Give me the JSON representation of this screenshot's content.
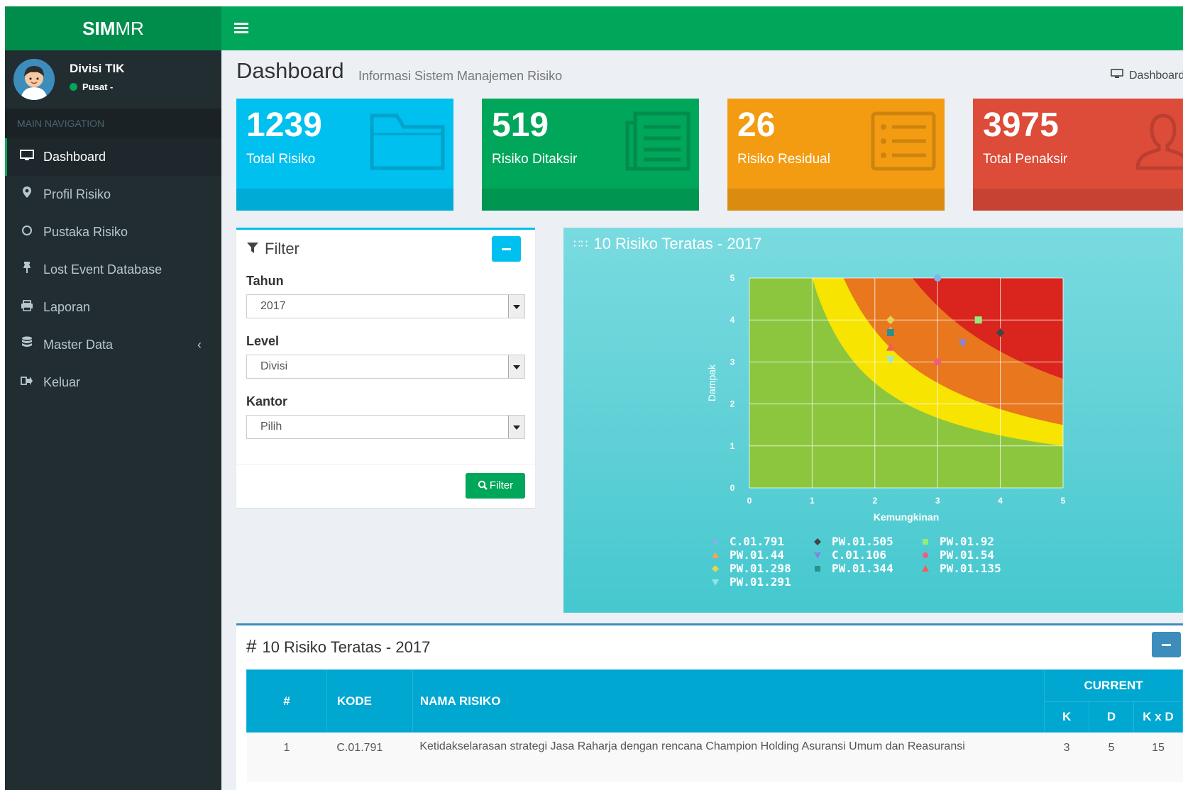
{
  "app": {
    "logo_bold": "SIM",
    "logo_rest": "MR"
  },
  "user": {
    "name": "Divisi TIK",
    "status": "Pusat -"
  },
  "nav": {
    "header": "MAIN NAVIGATION",
    "items": [
      {
        "label": "Dashboard",
        "icon": "monitor-icon"
      },
      {
        "label": "Profil Risiko",
        "icon": "map-marker-icon"
      },
      {
        "label": "Pustaka Risiko",
        "icon": "circle-icon"
      },
      {
        "label": "Lost Event Database",
        "icon": "pin-icon"
      },
      {
        "label": "Laporan",
        "icon": "print-icon"
      },
      {
        "label": "Master Data",
        "icon": "database-icon"
      },
      {
        "label": "Keluar",
        "icon": "sign-out-icon"
      }
    ]
  },
  "header": {
    "title": "Dashboard",
    "subtitle": "Informasi Sistem Manajemen Risiko",
    "breadcrumb": "Dashboard"
  },
  "stats": [
    {
      "value": "1239",
      "label": "Total Risiko",
      "color": "#00c0ef",
      "icon": "folder-icon"
    },
    {
      "value": "519",
      "label": "Risiko Ditaksir",
      "color": "#00a65a",
      "icon": "newspaper-icon"
    },
    {
      "value": "26",
      "label": "Risiko Residual",
      "color": "#f39c12",
      "icon": "list-icon"
    },
    {
      "value": "3975",
      "label": "Total Penaksir",
      "color": "#dd4b39",
      "icon": "user-icon"
    }
  ],
  "filter": {
    "title": "Filter",
    "tahun_label": "Tahun",
    "tahun_value": "2017",
    "level_label": "Level",
    "level_value": "Divisi",
    "kantor_label": "Kantor",
    "kantor_value": "Pilih",
    "button": "Filter"
  },
  "chart_box": {
    "title": "10 Risiko Teratas - 2017"
  },
  "chart_data": {
    "type": "scatter",
    "xlabel": "Kemungkinan",
    "ylabel": "Dampak",
    "xlim": [
      0,
      5
    ],
    "ylim": [
      0,
      5
    ],
    "x_ticks": [
      "0",
      "1",
      "2",
      "3",
      "4",
      "5"
    ],
    "y_ticks": [
      "0",
      "1",
      "2",
      "3",
      "4",
      "5"
    ],
    "grid": true,
    "legend_position": "bottom",
    "background_zones": [
      "#8cc63f",
      "#f7e400",
      "#e8771e",
      "#d9251d"
    ],
    "series": [
      {
        "name": "C.01.791",
        "marker": "circle",
        "color": "#7cb5ec",
        "x": 3.0,
        "y": 5.0
      },
      {
        "name": "PW.01.505",
        "marker": "diamond",
        "color": "#434348",
        "x": 4.0,
        "y": 3.7
      },
      {
        "name": "PW.01.92",
        "marker": "square",
        "color": "#90ed7d",
        "x": 3.65,
        "y": 4.0
      },
      {
        "name": "PW.01.44",
        "marker": "triangle",
        "color": "#f7a35c",
        "x": 2.25,
        "y": 3.75
      },
      {
        "name": "C.01.106",
        "marker": "triangle-down",
        "color": "#8085e9",
        "x": 3.4,
        "y": 3.45
      },
      {
        "name": "PW.01.54",
        "marker": "circle",
        "color": "#f15c80",
        "x": 3.0,
        "y": 3.0
      },
      {
        "name": "PW.01.298",
        "marker": "diamond",
        "color": "#e4d354",
        "x": 2.25,
        "y": 4.0
      },
      {
        "name": "PW.01.344",
        "marker": "square",
        "color": "#2b908f",
        "x": 2.25,
        "y": 3.7
      },
      {
        "name": "PW.01.135",
        "marker": "triangle",
        "color": "#f45b5b",
        "x": 2.25,
        "y": 3.35
      },
      {
        "name": "PW.01.291",
        "marker": "triangle-down",
        "color": "#91e8e1",
        "x": 2.25,
        "y": 3.05
      }
    ]
  },
  "table_box": {
    "title": "10 Risiko Teratas - 2017",
    "headers": {
      "no": "#",
      "kode": "KODE",
      "nama": "NAMA RISIKO",
      "current": "CURRENT",
      "k": "K",
      "d": "D",
      "kxd": "K x D"
    },
    "rows": [
      {
        "no": "1",
        "kode": "C.01.791",
        "nama": "Ketidakselarasan strategi Jasa Raharja dengan rencana Champion Holding Asuransi Umum dan Reasuransi",
        "k": "3",
        "d": "5",
        "kxd": "15"
      }
    ]
  }
}
